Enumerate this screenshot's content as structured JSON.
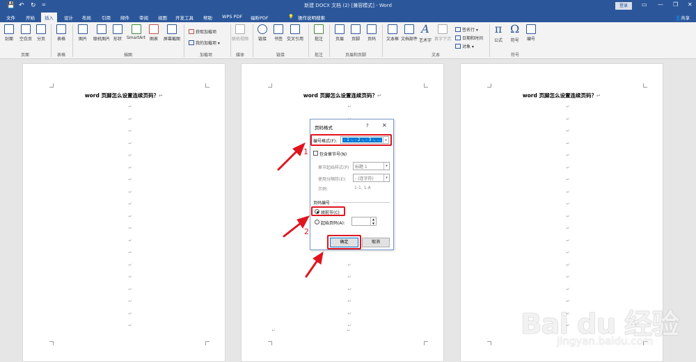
{
  "titlebar": {
    "quick_save": "💾",
    "quick_undo": "↶",
    "quick_redo": "↻",
    "quick_more": "=",
    "title": "新建 DOCX 文档 (2) [兼容模式] - Word",
    "login": "登录",
    "minimize": "—",
    "restore": "❐",
    "close": "✕"
  },
  "tabs": [
    "文件",
    "开始",
    "插入",
    "设计",
    "布局",
    "引用",
    "邮件",
    "审阅",
    "视图",
    "开发工具",
    "帮助",
    "WPS PDF",
    "福昕PDF"
  ],
  "active_tab": "插入",
  "tell_me": "操作说明搜索",
  "share": "共享",
  "ribbon": {
    "buttons": {
      "cover": "封面",
      "blank": "空白页",
      "pagebreak": "分页",
      "table": "表格",
      "picture": "图片",
      "online_picture": "联机图片",
      "shapes": "形状",
      "smartart": "SmartArt",
      "chart": "图表",
      "screenshot": "屏幕截图",
      "get_addins": "获取加载项",
      "my_addins": "我的加载项",
      "online_video": "联机视频",
      "link": "链接",
      "bookmark": "书签",
      "crossref": "交叉引用",
      "comment": "批注",
      "header": "页眉",
      "footer": "页脚",
      "pagenum": "页码",
      "textbox": "文本框",
      "docparts": "文档部件",
      "wordart": "艺术字",
      "dropcap": "首字下沉",
      "sigline": "签名行",
      "datetime": "日期和时间",
      "object": "对象",
      "equation": "公式",
      "symbol": "符号",
      "number": "编号"
    },
    "groups": {
      "pages": "页面",
      "tables": "表格",
      "illustrations": "插图",
      "addins": "加载项",
      "media": "媒体",
      "links": "链接",
      "comments": "批注",
      "headerfooter": "页眉和页脚",
      "text": "文本",
      "symbols": "符号"
    }
  },
  "document": {
    "heading": "word 页脚怎么设置连续页码？",
    "para_mark": "↵"
  },
  "dialog": {
    "title": "页码格式",
    "help": "?",
    "close": "✕",
    "number_format_label": "编号格式(F):",
    "number_format_value": "- 1 -, - 2 -, - 3 -, …",
    "include_chapter": "包含章节号(N)",
    "chapter_style_label": "章节起始样式(P)",
    "chapter_style_value": "标题 1",
    "separator_label": "使用分隔符(E):",
    "separator_value": "-  (连字符)",
    "example_label": "示例:",
    "example_value": "1-1, 1-A",
    "page_numbering": "页码编号",
    "continue_prev": "续前节(C)",
    "start_at": "起始页码(A):",
    "ok": "确定",
    "cancel": "取消"
  },
  "annotations": [
    "1",
    "2",
    "3"
  ],
  "watermark": {
    "logo": "Bai du 经验",
    "url": "jingyan.baidu.com"
  },
  "colors": {
    "accent": "#2b579a",
    "highlight": "#e0141e",
    "selection": "#0078d7"
  }
}
